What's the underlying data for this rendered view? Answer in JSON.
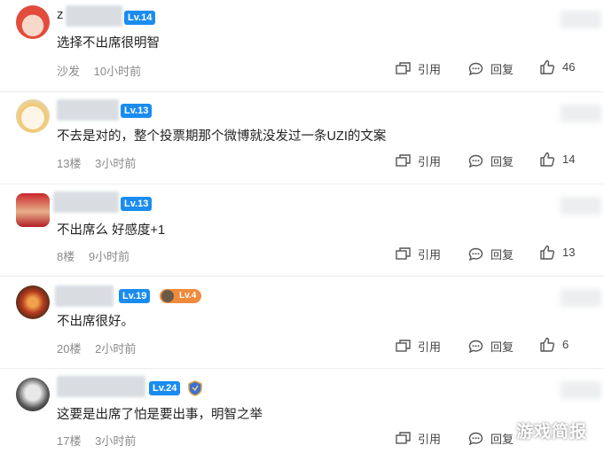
{
  "comments": [
    {
      "level": "Lv.14",
      "name_prefix": "z",
      "text": "选择不出席很明智",
      "floor": "沙发",
      "time": "10小时前",
      "reply_label": "引用",
      "quote_label": "回复",
      "likes": "46"
    },
    {
      "level": "Lv.13",
      "text": "不去是对的，整个投票期那个微博就没发过一条UZI的文案",
      "floor": "13楼",
      "time": "3小时前",
      "reply_label": "引用",
      "quote_label": "回复",
      "likes": "14"
    },
    {
      "level": "Lv.13",
      "text": "不出席么 好感度+1",
      "floor": "8楼",
      "time": "9小时前",
      "reply_label": "引用",
      "quote_label": "回复",
      "likes": "13"
    },
    {
      "level": "Lv.19",
      "sub_level": "Lv.4",
      "text": "不出席很好。",
      "floor": "20楼",
      "time": "2小时前",
      "reply_label": "引用",
      "quote_label": "回复",
      "likes": "6"
    },
    {
      "level": "Lv.24",
      "text": "这要是出席了怕是要出事，明智之举",
      "floor": "17楼",
      "time": "3小时前",
      "reply_label": "引用",
      "quote_label": "回复",
      "likes": ""
    }
  ],
  "watermark": "游戏简报",
  "colors": {
    "level_badge": "#1a8cf0",
    "sub_level_badge": "#f08a3c",
    "meta_text": "#8a8a8a"
  }
}
